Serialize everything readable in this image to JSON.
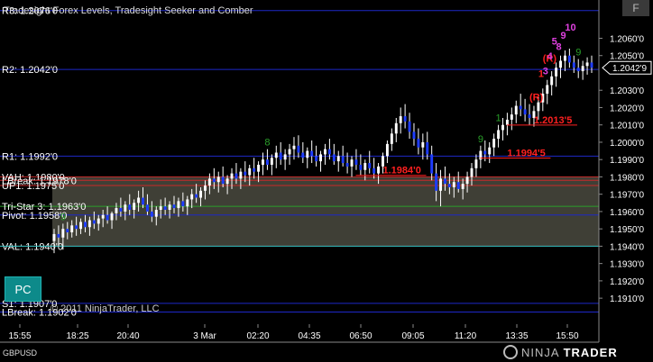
{
  "title": "Tradesight Forex Levels, Tradesight Seeker and Comber",
  "symbol": "GBPUSD",
  "copyright": "© 2011 NinjaTrader, LLC",
  "brand": {
    "light": "NINJA",
    "bold": "TRADER"
  },
  "buttons": {
    "pc": "PC",
    "f": "F"
  },
  "colors": {
    "up": "#ffffff",
    "down": "#1e3cff",
    "level_blue": "#1e28c8",
    "level_red": "#c82828",
    "value_area": "#4a4a40",
    "seeker": "#2aa02a",
    "comber": "#e040e0",
    "annot_red": "#ff2020"
  },
  "chart_data": {
    "type": "candlestick",
    "ylim": [
      1.1895,
      1.208
    ],
    "y_ticks": [
      "1.2060'0",
      "1.2050'0",
      "1.2030'0",
      "1.2020'0",
      "1.2010'0",
      "1.2000'0",
      "1.1990'0",
      "1.1980'0",
      "1.1970'0",
      "1.1960'0",
      "1.1950'0",
      "1.1940'0",
      "1.1930'0",
      "1.1920'0",
      "1.1910'0"
    ],
    "y_tick_values": [
      1.206,
      1.205,
      1.203,
      1.202,
      1.201,
      1.2,
      1.199,
      1.198,
      1.197,
      1.196,
      1.195,
      1.194,
      1.193,
      1.192,
      1.191
    ],
    "x_ticks": [
      "15:55",
      "18:25",
      "20:40",
      "3 Mar",
      "02:20",
      "04:35",
      "06:50",
      "09:05",
      "11:20",
      "13:35",
      "15:50"
    ],
    "last_price": "1.2042'9",
    "last_value": 1.2043,
    "levels": [
      {
        "label": "R3: 1.2076'0",
        "value": 1.2076,
        "color": "blue"
      },
      {
        "label": "R2: 1.2042'0",
        "value": 1.2042,
        "color": "blue"
      },
      {
        "label": "R1: 1.1992'0",
        "value": 1.1992,
        "color": "blue"
      },
      {
        "label": "VAH: 1.1980'0",
        "value": 1.198,
        "color": "red"
      },
      {
        "label": "LBreak: 1.1978'0",
        "value": 1.1978,
        "color": "red"
      },
      {
        "label": "UP1: 1.1975'0",
        "value": 1.1975,
        "color": "red"
      },
      {
        "label": "Tri-Star 3: 1.1963'0",
        "value": 1.1963,
        "color": "green"
      },
      {
        "label": "Pivot: 1.1958'0",
        "value": 1.1958,
        "color": "blue"
      },
      {
        "label": "VAL: 1.1940'0",
        "value": 1.194,
        "color": "red"
      },
      {
        "label": "S1: 1.1907'0",
        "value": 1.1907,
        "color": "blue"
      },
      {
        "label": "LBreak: 1.1902'0",
        "value": 1.1902,
        "color": "blue"
      }
    ],
    "value_area": [
      1.194,
      1.198
    ],
    "annotations": [
      {
        "text": "1.1984'0",
        "x_index": 74,
        "value": 1.1984
      },
      {
        "text": "1.1994'5",
        "x_index": 102,
        "value": 1.1994
      },
      {
        "text": "1.2013'5",
        "x_index": 108,
        "value": 1.2013
      }
    ],
    "seeker_labels": [
      "9",
      "8",
      "9",
      "1",
      "9"
    ],
    "comber_labels": [
      "(R)",
      "1",
      "(R)",
      "3",
      "4",
      "5",
      "8",
      "9",
      "10"
    ],
    "candles": [
      {
        "o": 1.1943,
        "h": 1.195,
        "l": 1.1936,
        "c": 1.1947
      },
      {
        "o": 1.1947,
        "h": 1.1952,
        "l": 1.194,
        "c": 1.1945
      },
      {
        "o": 1.1945,
        "h": 1.1953,
        "l": 1.1938,
        "c": 1.195
      },
      {
        "o": 1.195,
        "h": 1.1954,
        "l": 1.1944,
        "c": 1.1948
      },
      {
        "o": 1.1948,
        "h": 1.1955,
        "l": 1.1945,
        "c": 1.1952
      },
      {
        "o": 1.1952,
        "h": 1.1957,
        "l": 1.1946,
        "c": 1.195
      },
      {
        "o": 1.195,
        "h": 1.1956,
        "l": 1.1947,
        "c": 1.1954
      },
      {
        "o": 1.1954,
        "h": 1.1958,
        "l": 1.1948,
        "c": 1.1951
      },
      {
        "o": 1.1951,
        "h": 1.1957,
        "l": 1.1946,
        "c": 1.1955
      },
      {
        "o": 1.1955,
        "h": 1.196,
        "l": 1.195,
        "c": 1.1953
      },
      {
        "o": 1.1953,
        "h": 1.1958,
        "l": 1.1949,
        "c": 1.1956
      },
      {
        "o": 1.1956,
        "h": 1.1961,
        "l": 1.1951,
        "c": 1.1958
      },
      {
        "o": 1.1958,
        "h": 1.1963,
        "l": 1.1953,
        "c": 1.1955
      },
      {
        "o": 1.1955,
        "h": 1.196,
        "l": 1.195,
        "c": 1.1959
      },
      {
        "o": 1.1959,
        "h": 1.1965,
        "l": 1.1955,
        "c": 1.1962
      },
      {
        "o": 1.1962,
        "h": 1.1968,
        "l": 1.1957,
        "c": 1.196
      },
      {
        "o": 1.196,
        "h": 1.1966,
        "l": 1.1955,
        "c": 1.1964
      },
      {
        "o": 1.1964,
        "h": 1.197,
        "l": 1.1958,
        "c": 1.1961
      },
      {
        "o": 1.1961,
        "h": 1.1967,
        "l": 1.1956,
        "c": 1.1965
      },
      {
        "o": 1.1965,
        "h": 1.1972,
        "l": 1.196,
        "c": 1.1968
      },
      {
        "o": 1.1968,
        "h": 1.1974,
        "l": 1.1962,
        "c": 1.1964
      },
      {
        "o": 1.1964,
        "h": 1.197,
        "l": 1.1958,
        "c": 1.196
      },
      {
        "o": 1.196,
        "h": 1.1966,
        "l": 1.1954,
        "c": 1.1957
      },
      {
        "o": 1.1957,
        "h": 1.1963,
        "l": 1.1952,
        "c": 1.1961
      },
      {
        "o": 1.1961,
        "h": 1.1967,
        "l": 1.1956,
        "c": 1.1963
      },
      {
        "o": 1.1963,
        "h": 1.1968,
        "l": 1.1958,
        "c": 1.1961
      },
      {
        "o": 1.1961,
        "h": 1.1966,
        "l": 1.1956,
        "c": 1.1964
      },
      {
        "o": 1.1964,
        "h": 1.1969,
        "l": 1.1959,
        "c": 1.1962
      },
      {
        "o": 1.1962,
        "h": 1.1968,
        "l": 1.1957,
        "c": 1.1966
      },
      {
        "o": 1.1966,
        "h": 1.1971,
        "l": 1.196,
        "c": 1.1963
      },
      {
        "o": 1.1963,
        "h": 1.1969,
        "l": 1.1958,
        "c": 1.1967
      },
      {
        "o": 1.1967,
        "h": 1.1973,
        "l": 1.1962,
        "c": 1.197
      },
      {
        "o": 1.197,
        "h": 1.1976,
        "l": 1.1965,
        "c": 1.1968
      },
      {
        "o": 1.1968,
        "h": 1.1974,
        "l": 1.1963,
        "c": 1.1972
      },
      {
        "o": 1.1972,
        "h": 1.1978,
        "l": 1.1967,
        "c": 1.1975
      },
      {
        "o": 1.1975,
        "h": 1.1982,
        "l": 1.197,
        "c": 1.1979
      },
      {
        "o": 1.1979,
        "h": 1.1985,
        "l": 1.1973,
        "c": 1.1977
      },
      {
        "o": 1.1977,
        "h": 1.1983,
        "l": 1.1971,
        "c": 1.198
      },
      {
        "o": 1.198,
        "h": 1.1986,
        "l": 1.1974,
        "c": 1.1976
      },
      {
        "o": 1.1976,
        "h": 1.1981,
        "l": 1.197,
        "c": 1.1979
      },
      {
        "o": 1.1979,
        "h": 1.1985,
        "l": 1.1973,
        "c": 1.1982
      },
      {
        "o": 1.1982,
        "h": 1.1988,
        "l": 1.1976,
        "c": 1.1979
      },
      {
        "o": 1.1979,
        "h": 1.1985,
        "l": 1.1973,
        "c": 1.1983
      },
      {
        "o": 1.1983,
        "h": 1.1989,
        "l": 1.1977,
        "c": 1.1981
      },
      {
        "o": 1.1981,
        "h": 1.1987,
        "l": 1.1975,
        "c": 1.1985
      },
      {
        "o": 1.1985,
        "h": 1.1991,
        "l": 1.1979,
        "c": 1.1983
      },
      {
        "o": 1.1983,
        "h": 1.1989,
        "l": 1.1977,
        "c": 1.1987
      },
      {
        "o": 1.1987,
        "h": 1.1994,
        "l": 1.1981,
        "c": 1.199
      },
      {
        "o": 1.199,
        "h": 1.1996,
        "l": 1.1984,
        "c": 1.1987
      },
      {
        "o": 1.1987,
        "h": 1.1993,
        "l": 1.1981,
        "c": 1.1991
      },
      {
        "o": 1.1991,
        "h": 1.1998,
        "l": 1.1985,
        "c": 1.1994
      },
      {
        "o": 1.1994,
        "h": 1.2,
        "l": 1.1987,
        "c": 1.199
      },
      {
        "o": 1.199,
        "h": 1.1996,
        "l": 1.1984,
        "c": 1.1993
      },
      {
        "o": 1.1993,
        "h": 1.1999,
        "l": 1.1987,
        "c": 1.1996
      },
      {
        "o": 1.1996,
        "h": 1.2003,
        "l": 1.199,
        "c": 1.1998
      },
      {
        "o": 1.1998,
        "h": 1.2004,
        "l": 1.1991,
        "c": 1.1994
      },
      {
        "o": 1.1994,
        "h": 1.2,
        "l": 1.1988,
        "c": 1.1991
      },
      {
        "o": 1.1991,
        "h": 1.1997,
        "l": 1.1985,
        "c": 1.1995
      },
      {
        "o": 1.1995,
        "h": 1.2001,
        "l": 1.1988,
        "c": 1.1992
      },
      {
        "o": 1.1992,
        "h": 1.1998,
        "l": 1.1986,
        "c": 1.1989
      },
      {
        "o": 1.1989,
        "h": 1.1995,
        "l": 1.1983,
        "c": 1.1993
      },
      {
        "o": 1.1993,
        "h": 1.1999,
        "l": 1.1987,
        "c": 1.1996
      },
      {
        "o": 1.1996,
        "h": 1.2002,
        "l": 1.199,
        "c": 1.1993
      },
      {
        "o": 1.1993,
        "h": 1.1999,
        "l": 1.1987,
        "c": 1.1989
      },
      {
        "o": 1.1989,
        "h": 1.1995,
        "l": 1.1983,
        "c": 1.1992
      },
      {
        "o": 1.1992,
        "h": 1.1998,
        "l": 1.1986,
        "c": 1.1988
      },
      {
        "o": 1.1988,
        "h": 1.1994,
        "l": 1.1982,
        "c": 1.1986
      },
      {
        "o": 1.1986,
        "h": 1.1992,
        "l": 1.198,
        "c": 1.199
      },
      {
        "o": 1.199,
        "h": 1.1996,
        "l": 1.1984,
        "c": 1.1987
      },
      {
        "o": 1.1987,
        "h": 1.1993,
        "l": 1.1981,
        "c": 1.1984
      },
      {
        "o": 1.1984,
        "h": 1.199,
        "l": 1.1978,
        "c": 1.1988
      },
      {
        "o": 1.1988,
        "h": 1.1995,
        "l": 1.1982,
        "c": 1.1985
      },
      {
        "o": 1.1985,
        "h": 1.1991,
        "l": 1.1979,
        "c": 1.1982
      },
      {
        "o": 1.1982,
        "h": 1.1988,
        "l": 1.1976,
        "c": 1.1986
      },
      {
        "o": 1.1986,
        "h": 1.1994,
        "l": 1.1982,
        "c": 1.1992
      },
      {
        "o": 1.1992,
        "h": 1.2001,
        "l": 1.1988,
        "c": 1.1999
      },
      {
        "o": 1.1999,
        "h": 1.2008,
        "l": 1.1995,
        "c": 1.2005
      },
      {
        "o": 1.2005,
        "h": 1.2014,
        "l": 1.2,
        "c": 1.2011
      },
      {
        "o": 1.2011,
        "h": 1.202,
        "l": 1.2005,
        "c": 1.2015
      },
      {
        "o": 1.2015,
        "h": 1.2022,
        "l": 1.2008,
        "c": 1.2012
      },
      {
        "o": 1.2012,
        "h": 1.2017,
        "l": 1.2002,
        "c": 1.2006
      },
      {
        "o": 1.2006,
        "h": 1.2011,
        "l": 1.1998,
        "c": 1.2002
      },
      {
        "o": 1.2002,
        "h": 1.2008,
        "l": 1.1993,
        "c": 1.1997
      },
      {
        "o": 1.1997,
        "h": 1.2005,
        "l": 1.199,
        "c": 1.2
      },
      {
        "o": 1.2,
        "h": 1.2006,
        "l": 1.199,
        "c": 1.1993
      },
      {
        "o": 1.1993,
        "h": 1.1998,
        "l": 1.1978,
        "c": 1.1982
      },
      {
        "o": 1.1982,
        "h": 1.1988,
        "l": 1.1966,
        "c": 1.1972
      },
      {
        "o": 1.1972,
        "h": 1.1984,
        "l": 1.1963,
        "c": 1.1979
      },
      {
        "o": 1.1979,
        "h": 1.1986,
        "l": 1.1972,
        "c": 1.1976
      },
      {
        "o": 1.1976,
        "h": 1.1982,
        "l": 1.197,
        "c": 1.1974
      },
      {
        "o": 1.1974,
        "h": 1.198,
        "l": 1.1968,
        "c": 1.1977
      },
      {
        "o": 1.1977,
        "h": 1.1983,
        "l": 1.1971,
        "c": 1.1973
      },
      {
        "o": 1.1973,
        "h": 1.1979,
        "l": 1.1967,
        "c": 1.1976
      },
      {
        "o": 1.1976,
        "h": 1.1983,
        "l": 1.1971,
        "c": 1.198
      },
      {
        "o": 1.198,
        "h": 1.1988,
        "l": 1.1975,
        "c": 1.1985
      },
      {
        "o": 1.1985,
        "h": 1.1993,
        "l": 1.198,
        "c": 1.199
      },
      {
        "o": 1.199,
        "h": 1.1998,
        "l": 1.1985,
        "c": 1.1995
      },
      {
        "o": 1.1995,
        "h": 1.2001,
        "l": 1.1989,
        "c": 1.1993
      },
      {
        "o": 1.1993,
        "h": 1.2,
        "l": 1.1988,
        "c": 1.1997
      },
      {
        "o": 1.1997,
        "h": 1.2005,
        "l": 1.1992,
        "c": 1.2002
      },
      {
        "o": 1.2002,
        "h": 1.201,
        "l": 1.1997,
        "c": 1.2007
      },
      {
        "o": 1.2007,
        "h": 1.2014,
        "l": 1.2001,
        "c": 1.201
      },
      {
        "o": 1.201,
        "h": 1.2017,
        "l": 1.2004,
        "c": 1.2013
      },
      {
        "o": 1.2013,
        "h": 1.202,
        "l": 1.2007,
        "c": 1.2016
      },
      {
        "o": 1.2016,
        "h": 1.2024,
        "l": 1.2011,
        "c": 1.2021
      },
      {
        "o": 1.2021,
        "h": 1.2028,
        "l": 1.2015,
        "c": 1.2019
      },
      {
        "o": 1.2019,
        "h": 1.2025,
        "l": 1.2012,
        "c": 1.2016
      },
      {
        "o": 1.2016,
        "h": 1.2022,
        "l": 1.201,
        "c": 1.2014
      },
      {
        "o": 1.2014,
        "h": 1.2021,
        "l": 1.2009,
        "c": 1.2018
      },
      {
        "o": 1.2018,
        "h": 1.2026,
        "l": 1.2013,
        "c": 1.2023
      },
      {
        "o": 1.2023,
        "h": 1.2031,
        "l": 1.2018,
        "c": 1.2028
      },
      {
        "o": 1.2028,
        "h": 1.2036,
        "l": 1.2022,
        "c": 1.2033
      },
      {
        "o": 1.2033,
        "h": 1.2041,
        "l": 1.2027,
        "c": 1.2038
      },
      {
        "o": 1.2038,
        "h": 1.2046,
        "l": 1.2032,
        "c": 1.2043
      },
      {
        "o": 1.2043,
        "h": 1.205,
        "l": 1.2037,
        "c": 1.2047
      },
      {
        "o": 1.2047,
        "h": 1.2053,
        "l": 1.2041,
        "c": 1.205
      },
      {
        "o": 1.205,
        "h": 1.2054,
        "l": 1.2043,
        "c": 1.2046
      },
      {
        "o": 1.2046,
        "h": 1.205,
        "l": 1.204,
        "c": 1.2043
      },
      {
        "o": 1.2043,
        "h": 1.2048,
        "l": 1.2037,
        "c": 1.2041
      },
      {
        "o": 1.2041,
        "h": 1.2047,
        "l": 1.2036,
        "c": 1.2044
      },
      {
        "o": 1.2044,
        "h": 1.2049,
        "l": 1.2039,
        "c": 1.2046
      },
      {
        "o": 1.2046,
        "h": 1.205,
        "l": 1.204,
        "c": 1.2043
      }
    ]
  }
}
